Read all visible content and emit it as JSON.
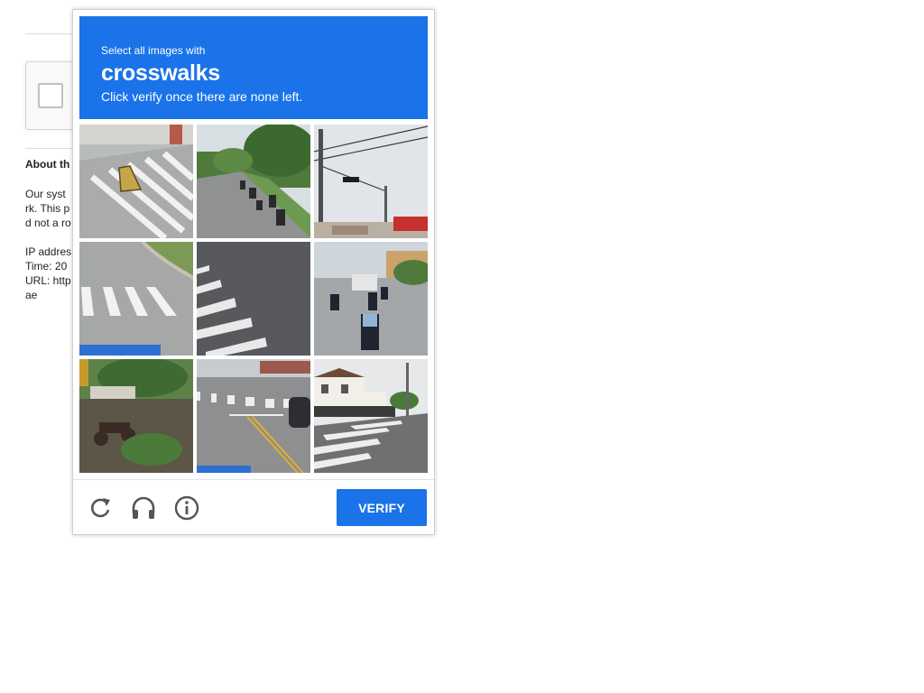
{
  "background_page": {
    "heading": "About th",
    "lines": [
      "Our syst",
      "rk. This p",
      "d not a ro",
      "IP addres",
      "Time: 20",
      "URL: http",
      "ae"
    ]
  },
  "challenge": {
    "prompt": "Select all images with",
    "target": "crosswalks",
    "subtext": "Click verify once there are none left.",
    "tiles": [
      {
        "scene": "crosswalk close-up with small sign"
      },
      {
        "scene": "road with motorcycles and trees"
      },
      {
        "scene": "traffic light and power lines"
      },
      {
        "scene": "curved road with crosswalk"
      },
      {
        "scene": "asphalt with crosswalk stripes"
      },
      {
        "scene": "street with motorcyclists"
      },
      {
        "scene": "garden with motorcycle"
      },
      {
        "scene": "road with crosswalk and yellow lines"
      },
      {
        "scene": "crosswalk near white house"
      }
    ],
    "footer": {
      "reload_icon": "reload-icon",
      "audio_icon": "headphones-icon",
      "info_icon": "info-icon",
      "verify_label": "VERIFY"
    },
    "colors": {
      "accent": "#1a73e8"
    }
  }
}
